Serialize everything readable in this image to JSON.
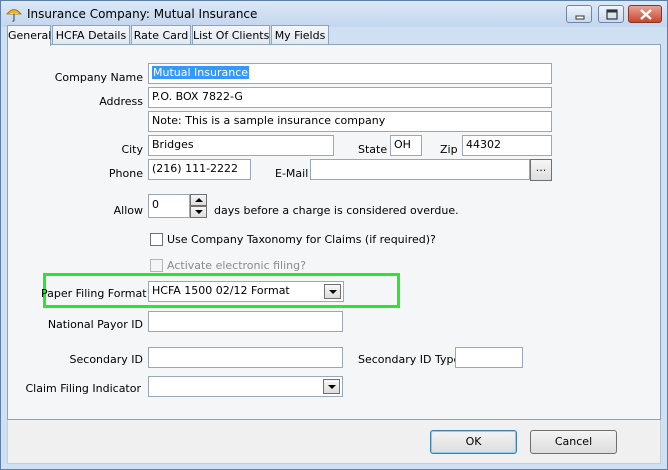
{
  "window": {
    "title": "Insurance Company: Mutual Insurance",
    "app_icon": "umbrella-icon",
    "controls": [
      "minimize-icon",
      "restore-icon",
      "close-icon"
    ]
  },
  "tabs": [
    {
      "label": "General",
      "active": true
    },
    {
      "label": "HCFA Details",
      "active": false
    },
    {
      "label": "Rate Card",
      "active": false
    },
    {
      "label": "List Of Clients",
      "active": false
    },
    {
      "label": "My Fields",
      "active": false
    }
  ],
  "form": {
    "company_name_label": "Company Name",
    "company_name_value": "Mutual Insurance",
    "address_label": "Address",
    "address_line1": "P.O. BOX 7822-G",
    "address_line2": "Note: This is a sample insurance company",
    "city_label": "City",
    "city_value": "Bridges",
    "state_label": "State",
    "state_value": "OH",
    "zip_label": "Zip",
    "zip_value": "44302",
    "phone_label": "Phone",
    "phone_value": "(216) 111-2222",
    "email_label": "E-Mail",
    "email_value": "",
    "browse_label": "...",
    "allow_label": "Allow",
    "allow_days_value": "0",
    "allow_suffix": "days before a charge is considered overdue.",
    "taxonomy_label": "Use Company Taxonomy for Claims (if required)?",
    "taxonomy_checked": false,
    "electronic_label": "Activate electronic filing?",
    "electronic_checked": false,
    "paper_format_label": "Paper Filing Format",
    "paper_format_value": "HCFA 1500 02/12 Format",
    "national_payor_label": "National Payor ID",
    "national_payor_value": "",
    "secondary_id_label": "Secondary ID",
    "secondary_id_value": "",
    "secondary_id_type_label": "Secondary ID Type",
    "secondary_id_type_value": "",
    "claim_filing_label": "Claim Filing Indicator",
    "claim_filing_value": ""
  },
  "buttons": {
    "ok": "OK",
    "cancel": "Cancel"
  },
  "colors": {
    "highlight": "#2ee52e",
    "selection": "#3399ff"
  }
}
